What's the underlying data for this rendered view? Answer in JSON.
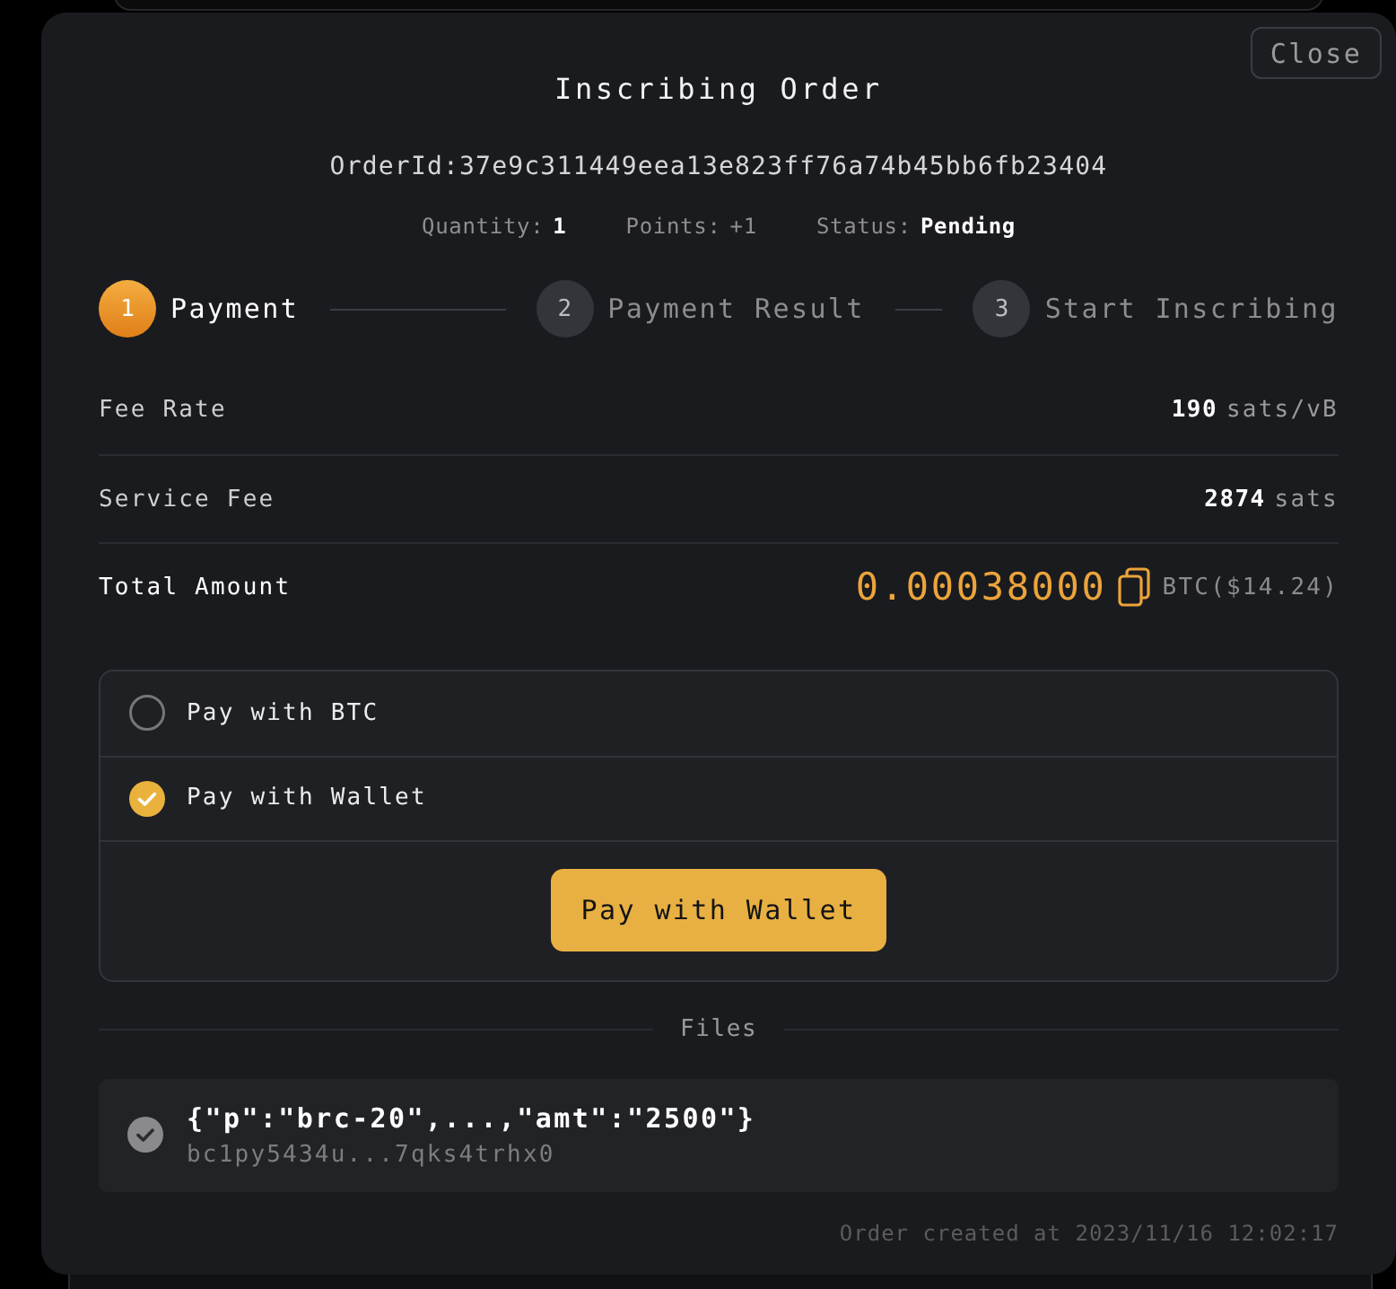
{
  "window": {
    "title": "Inscribing Order",
    "close_button": "Close"
  },
  "order_id": "OrderId:37e9c311449eea13e823ff76a74b45bb6fb23404",
  "summary": [
    {
      "label": "Quantity:",
      "value": "1",
      "highlighted": true
    },
    {
      "label": "Points:",
      "value": "+1",
      "highlighted": false
    },
    {
      "label": "Status:",
      "value": "Pending",
      "highlighted": true
    }
  ],
  "steps": [
    {
      "number": "1",
      "label": "Payment",
      "selected": true
    },
    {
      "number": "2",
      "label": "Payment Result",
      "selected": false
    },
    {
      "number": "3",
      "label": "Start Inscribing",
      "selected": false
    }
  ],
  "fees": [
    {
      "kind": "plain",
      "label": "Fee Rate",
      "value": "190",
      "unit": "sats/vB"
    },
    {
      "kind": "plain",
      "label": "Service Fee",
      "value": "2874",
      "unit": "sats"
    },
    {
      "kind": "total",
      "label": "Total Amount",
      "value": "0.00038000",
      "unit": "BTC($14.24)"
    }
  ],
  "payment_options": [
    {
      "label": "Pay with BTC",
      "selected": false
    },
    {
      "label": "Pay with Wallet",
      "selected": true
    }
  ],
  "pay_button": "Pay with Wallet",
  "files": {
    "heading": "Files",
    "items": [
      {
        "title": "{\"p\":\"brc-20\",...,\"amt\":\"2500\"}",
        "address": "bc1py5434u...7qks4trhx0",
        "checked": true
      }
    ]
  },
  "footer": "Order created at 2023/11/16 12:02:17"
}
